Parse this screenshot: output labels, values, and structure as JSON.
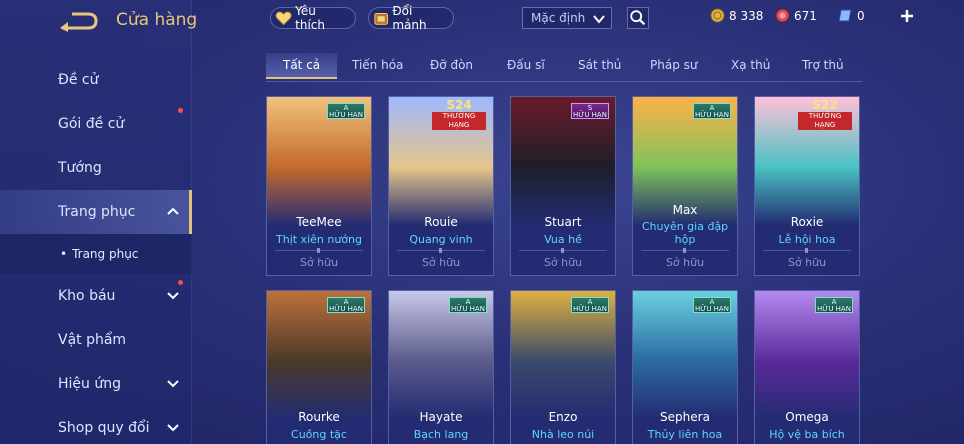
{
  "header": {
    "title": "Cửa hàng",
    "favorites_label": "Yêu thích",
    "exchange_label": "Đổi mảnh",
    "sort_value": "Mặc định",
    "currencies": [
      {
        "icon": "gold-coin-icon",
        "value": "8 338"
      },
      {
        "icon": "ruby-icon",
        "value": "671"
      },
      {
        "icon": "voucher-icon",
        "value": "0"
      }
    ]
  },
  "sidebar": {
    "items": [
      {
        "label": "Đề cử",
        "badge": false
      },
      {
        "label": "Gói đề cử",
        "badge": true
      },
      {
        "label": "Tướng",
        "badge": false
      },
      {
        "label": "Trang phục",
        "badge": false,
        "active": true,
        "expanded": true
      },
      {
        "label": "Trang phục",
        "sub": true
      },
      {
        "label": "Kho báu",
        "badge": true
      },
      {
        "label": "Vật phẩm",
        "badge": false
      },
      {
        "label": "Hiệu ứng",
        "badge": false
      },
      {
        "label": "Shop quy đổi",
        "badge": false
      }
    ]
  },
  "tabs": [
    "Tất cả",
    "Tiến hóa",
    "Đỡ đòn",
    "Đấu sĩ",
    "Sát thủ",
    "Pháp sư",
    "Xạ thủ",
    "Trợ thủ"
  ],
  "active_tab": "Tất cả",
  "cards": [
    {
      "name": "TeeMee",
      "skin": "Thịt xiên nướng",
      "status": "Sở hữu",
      "grade": "A",
      "grade_sub": "HỮU HẠN",
      "colors": [
        "#f0c27a",
        "#c46a2e"
      ]
    },
    {
      "name": "Rouie",
      "skin": "Quang vinh",
      "status": "Sở hữu",
      "season": "S24",
      "season_label": "THƯỞNG HẠNG",
      "colors": [
        "#9fb8ff",
        "#e6c58a"
      ]
    },
    {
      "name": "Stuart",
      "skin": "Vua hề",
      "status": "Sở hữu",
      "grade": "S",
      "grade_sub": "HỮU HẠN",
      "colors": [
        "#6a1b2a",
        "#1e1e2a"
      ]
    },
    {
      "name": "Max",
      "skin": "Chuyên gia đập hộp",
      "status": "Sở hữu",
      "grade": "A",
      "grade_sub": "HỮU HẠN",
      "colors": [
        "#ffb04a",
        "#7fc35a"
      ]
    },
    {
      "name": "Roxie",
      "skin": "Lễ hội hoa",
      "status": "Sở hữu",
      "season": "S22",
      "season_label": "THƯỞNG HẠNG",
      "colors": [
        "#ffc1d9",
        "#49c2c2"
      ]
    },
    {
      "name": "Rourke",
      "skin": "Cuồng tặc",
      "grade": "A",
      "grade_sub": "HỮU HẠN",
      "colors": [
        "#c0703a",
        "#4a3a2a"
      ]
    },
    {
      "name": "Hayate",
      "skin": "Bạch lang",
      "grade": "A",
      "grade_sub": "HỮU HẠN",
      "colors": [
        "#c8c8e8",
        "#5a5a8a"
      ]
    },
    {
      "name": "Enzo",
      "skin": "Nhà leo núi",
      "grade": "A",
      "grade_sub": "HỮU HẠN",
      "colors": [
        "#e0b040",
        "#3a4a6a"
      ]
    },
    {
      "name": "Sephera",
      "skin": "Thủy liên hoa",
      "grade": "A",
      "grade_sub": "HỮU HẠN",
      "colors": [
        "#6ad0e0",
        "#2a6aa0"
      ]
    },
    {
      "name": "Omega",
      "skin": "Hộ vệ ba bích",
      "grade": "A",
      "grade_sub": "HỮU HẠN",
      "colors": [
        "#b48af0",
        "#5a2a9a"
      ]
    }
  ],
  "colors": {
    "accent_gold": "#e2c27a",
    "skin_name": "#5fd6ff",
    "badge_red": "#ff4a4a"
  }
}
